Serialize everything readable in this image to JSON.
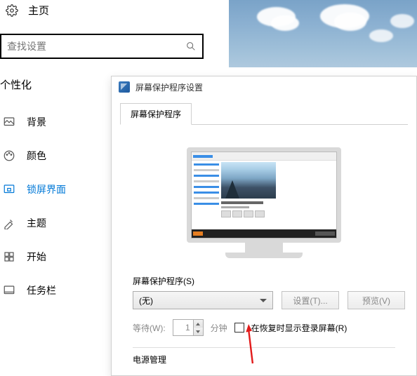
{
  "settings": {
    "home_label": "主页",
    "search_placeholder": "查找设置",
    "section": "个性化",
    "nav": [
      {
        "label": "背景"
      },
      {
        "label": "颜色"
      },
      {
        "label": "锁屏界面"
      },
      {
        "label": "主题"
      },
      {
        "label": "开始"
      },
      {
        "label": "任务栏"
      }
    ]
  },
  "dialog": {
    "title": "屏幕保护程序设置",
    "tab": "屏幕保护程序",
    "group_label": "屏幕保护程序(S)",
    "combo_value": "(无)",
    "settings_btn": "设置(T)...",
    "preview_btn": "预览(V)",
    "wait_label": "等待(W):",
    "wait_value": "1",
    "wait_unit": "分钟",
    "checkbox_label": "在恢复时显示登录屏幕(R)",
    "power_heading": "电源管理"
  }
}
